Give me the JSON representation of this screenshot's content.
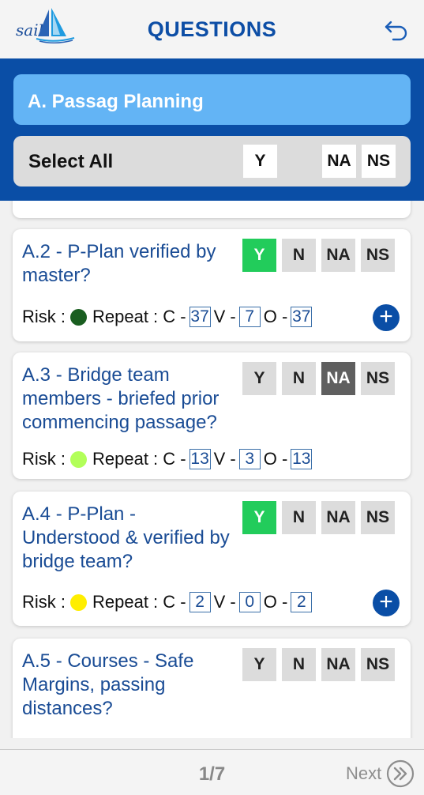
{
  "header": {
    "logo_text": "sail",
    "title": "QUESTIONS",
    "back_icon": "back-arrow-icon"
  },
  "section": {
    "title": "A. Passag Planning",
    "select_all_label": "Select All",
    "select_all_buttons": [
      "Y",
      "NA",
      "NS"
    ]
  },
  "answer_options": [
    "Y",
    "N",
    "NA",
    "NS"
  ],
  "questions": [
    {
      "text": "A.2 - P-Plan verified by master?",
      "selected": "Y",
      "risk_label": "Risk :",
      "risk_color": "#1a5e20",
      "repeat_label": "Repeat : C -",
      "c": "37",
      "v_label": "V -",
      "v": "7",
      "o_label": "O -",
      "o": "37",
      "has_add": true
    },
    {
      "text": "A.3 - Bridge team members - briefed prior commencing passage?",
      "selected": "NA",
      "risk_label": "Risk :",
      "risk_color": "#b2ff59",
      "repeat_label": "Repeat : C -",
      "c": "13",
      "v_label": "V -",
      "v": "3",
      "o_label": "O -",
      "o": "13",
      "has_add": false
    },
    {
      "text": "A.4 - P-Plan - Understood & verified by bridge team?",
      "selected": "Y",
      "risk_label": "Risk :",
      "risk_color": "#ffee00",
      "repeat_label": "Repeat : C -",
      "c": "2",
      "v_label": "V -",
      "v": "0",
      "o_label": "O -",
      "o": "2",
      "has_add": true
    },
    {
      "text": "A.5 - Courses - Safe Margins, passing distances?",
      "selected": "",
      "has_add": false
    }
  ],
  "footer": {
    "page_indicator": "1/7",
    "next_label": "Next",
    "next_icon": "double-chevron-right-icon"
  },
  "colors": {
    "brand_blue": "#0a4ea6",
    "section_blue": "#63b4f5",
    "selected_yes": "#22cc5b",
    "selected_na": "#5f5f5f"
  }
}
